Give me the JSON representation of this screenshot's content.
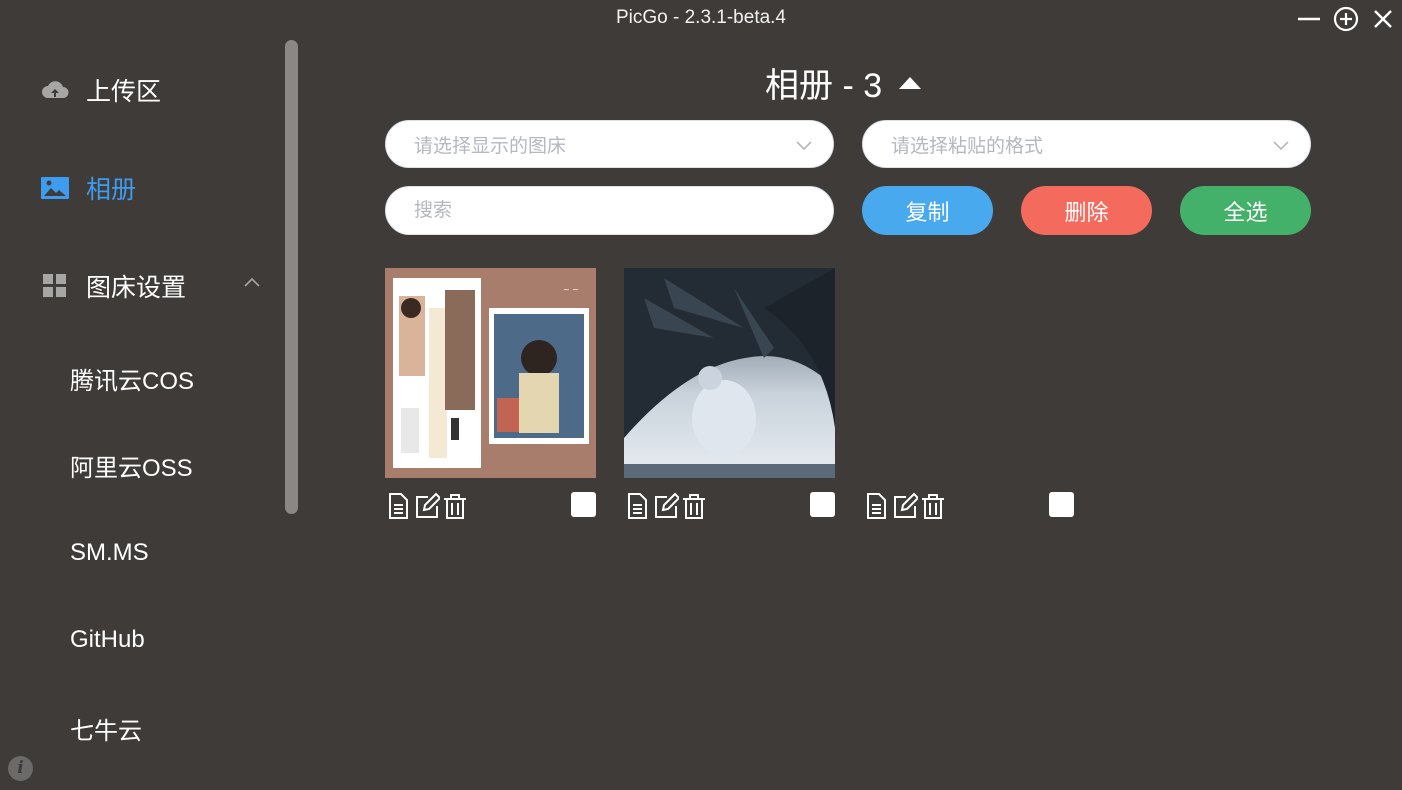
{
  "window": {
    "title": "PicGo - 2.3.1-beta.4"
  },
  "sidebar": {
    "items": [
      {
        "label": "上传区",
        "icon": "cloud-upload-icon",
        "active": false
      },
      {
        "label": "相册",
        "icon": "image-icon",
        "active": true
      },
      {
        "label": "图床设置",
        "icon": "grid-icon",
        "active": false,
        "expanded": true
      }
    ],
    "sub_items": [
      "腾讯云COS",
      "阿里云OSS",
      "SM.MS",
      "GitHub",
      "七牛云"
    ]
  },
  "gallery": {
    "title": "相册 - 3",
    "picbed_select_placeholder": "请选择显示的图床",
    "format_select_placeholder": "请选择粘贴的格式",
    "search_placeholder": "搜索",
    "buttons": {
      "copy": "复制",
      "delete": "删除",
      "select_all": "全选"
    },
    "images": [
      {
        "alt": "outfit collage",
        "checked": false
      },
      {
        "alt": "winged figure",
        "checked": false
      },
      {
        "alt": "",
        "checked": false
      }
    ]
  },
  "colors": {
    "background": "#3f3b38",
    "accent": "#3d9cf0",
    "copy_button": "#49a9ee",
    "delete_button": "#f46b5e",
    "select_all_button": "#44b16b"
  }
}
